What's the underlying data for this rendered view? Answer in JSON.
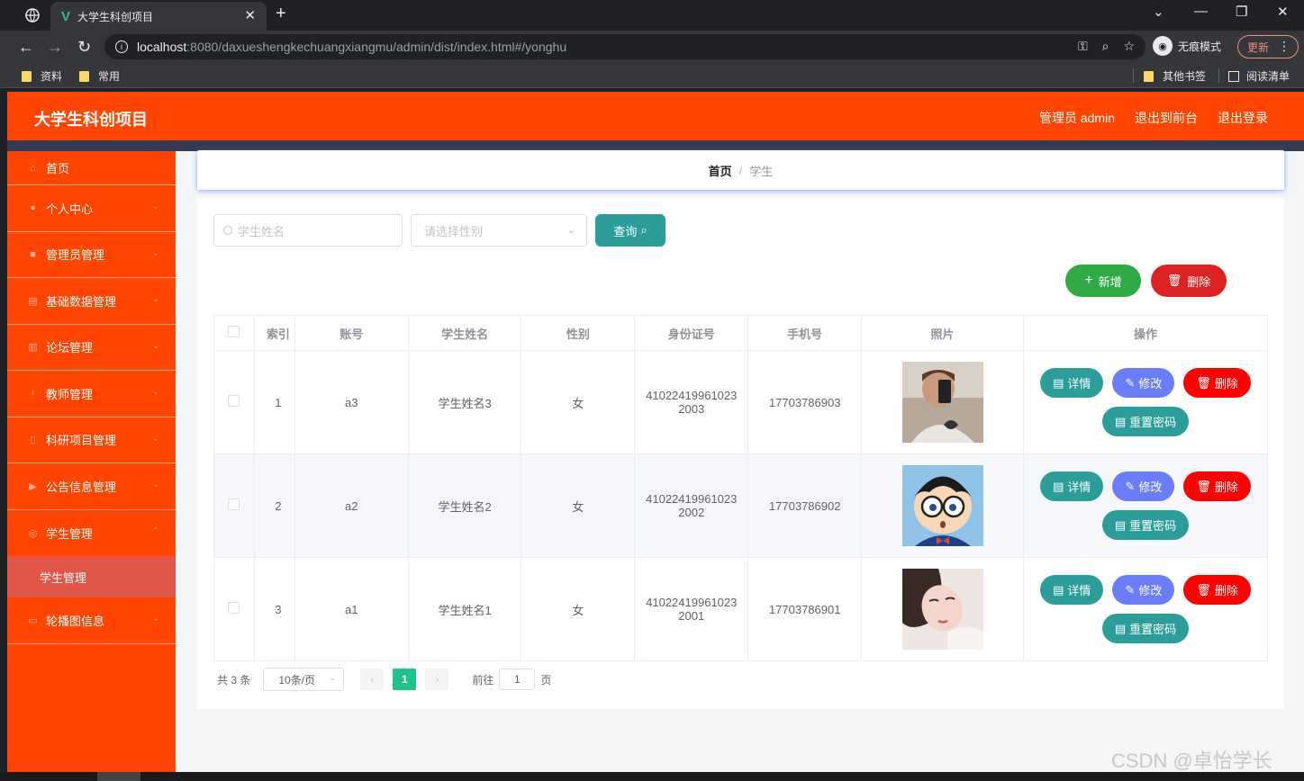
{
  "browser": {
    "tab_title": "大学生科创项目",
    "url_host": "localhost",
    "url_path": ":8080/daxueshengkechuangxiangmu/admin/dist/index.html#/yonghu",
    "incognito_label": "无痕模式",
    "update_label": "更新",
    "bookmarks": [
      "资料",
      "常用"
    ],
    "other_bookmarks": "其他书签",
    "reading_list": "阅读清单"
  },
  "header": {
    "title": "大学生科创项目",
    "user_label": "管理员 admin",
    "to_front": "退出到前台",
    "logout": "退出登录"
  },
  "sidebar": {
    "items": [
      {
        "label": "首页",
        "icon": "home-icon"
      },
      {
        "label": "个人中心",
        "icon": "user-icon"
      },
      {
        "label": "管理员管理",
        "icon": "briefcase-icon"
      },
      {
        "label": "基础数据管理",
        "icon": "chart-icon"
      },
      {
        "label": "论坛管理",
        "icon": "document-icon"
      },
      {
        "label": "教师管理",
        "icon": "microphone-icon"
      },
      {
        "label": "科研项目管理",
        "icon": "device-icon"
      },
      {
        "label": "公告信息管理",
        "icon": "video-icon"
      },
      {
        "label": "学生管理",
        "icon": "circle-icon"
      }
    ],
    "submenu_label": "学生管理",
    "last_item": {
      "label": "轮播图信息",
      "icon": "monitor-icon"
    }
  },
  "breadcrumb": {
    "home": "首页",
    "sep": "/",
    "current": "学生"
  },
  "filters": {
    "name_placeholder": "学生姓名",
    "gender_placeholder": "请选择性别",
    "query_label": "查询"
  },
  "actions": {
    "add_label": "新增",
    "delete_label": "删除"
  },
  "table": {
    "headers": [
      "索引",
      "账号",
      "学生姓名",
      "性别",
      "身份证号",
      "手机号",
      "照片",
      "操作"
    ],
    "rows": [
      {
        "index": "1",
        "account": "a3",
        "name": "学生姓名3",
        "gender": "女",
        "id_line1": "41022419961023",
        "id_line2": "2003",
        "phone": "17703786903"
      },
      {
        "index": "2",
        "account": "a2",
        "name": "学生姓名2",
        "gender": "女",
        "id_line1": "41022419961023",
        "id_line2": "2002",
        "phone": "17703786902"
      },
      {
        "index": "3",
        "account": "a1",
        "name": "学生姓名1",
        "gender": "女",
        "id_line1": "41022419961023",
        "id_line2": "2001",
        "phone": "17703786901"
      }
    ],
    "op_labels": {
      "detail": "详情",
      "edit": "修改",
      "delete": "删除",
      "reset": "重置密码"
    }
  },
  "pagination": {
    "total": "共 3 条",
    "page_size": "10条/页",
    "current_page": "1",
    "goto_label": "前往",
    "goto_value": "1",
    "page_suffix": "页"
  },
  "watermark": "CSDN @卓怡学长",
  "colors": {
    "header": "#ff4500",
    "sidebar": "#ff4500",
    "teal": "#2b9e9c",
    "green": "#2faa44",
    "red": "#dd2222",
    "pager_active": "#1ec38b"
  }
}
